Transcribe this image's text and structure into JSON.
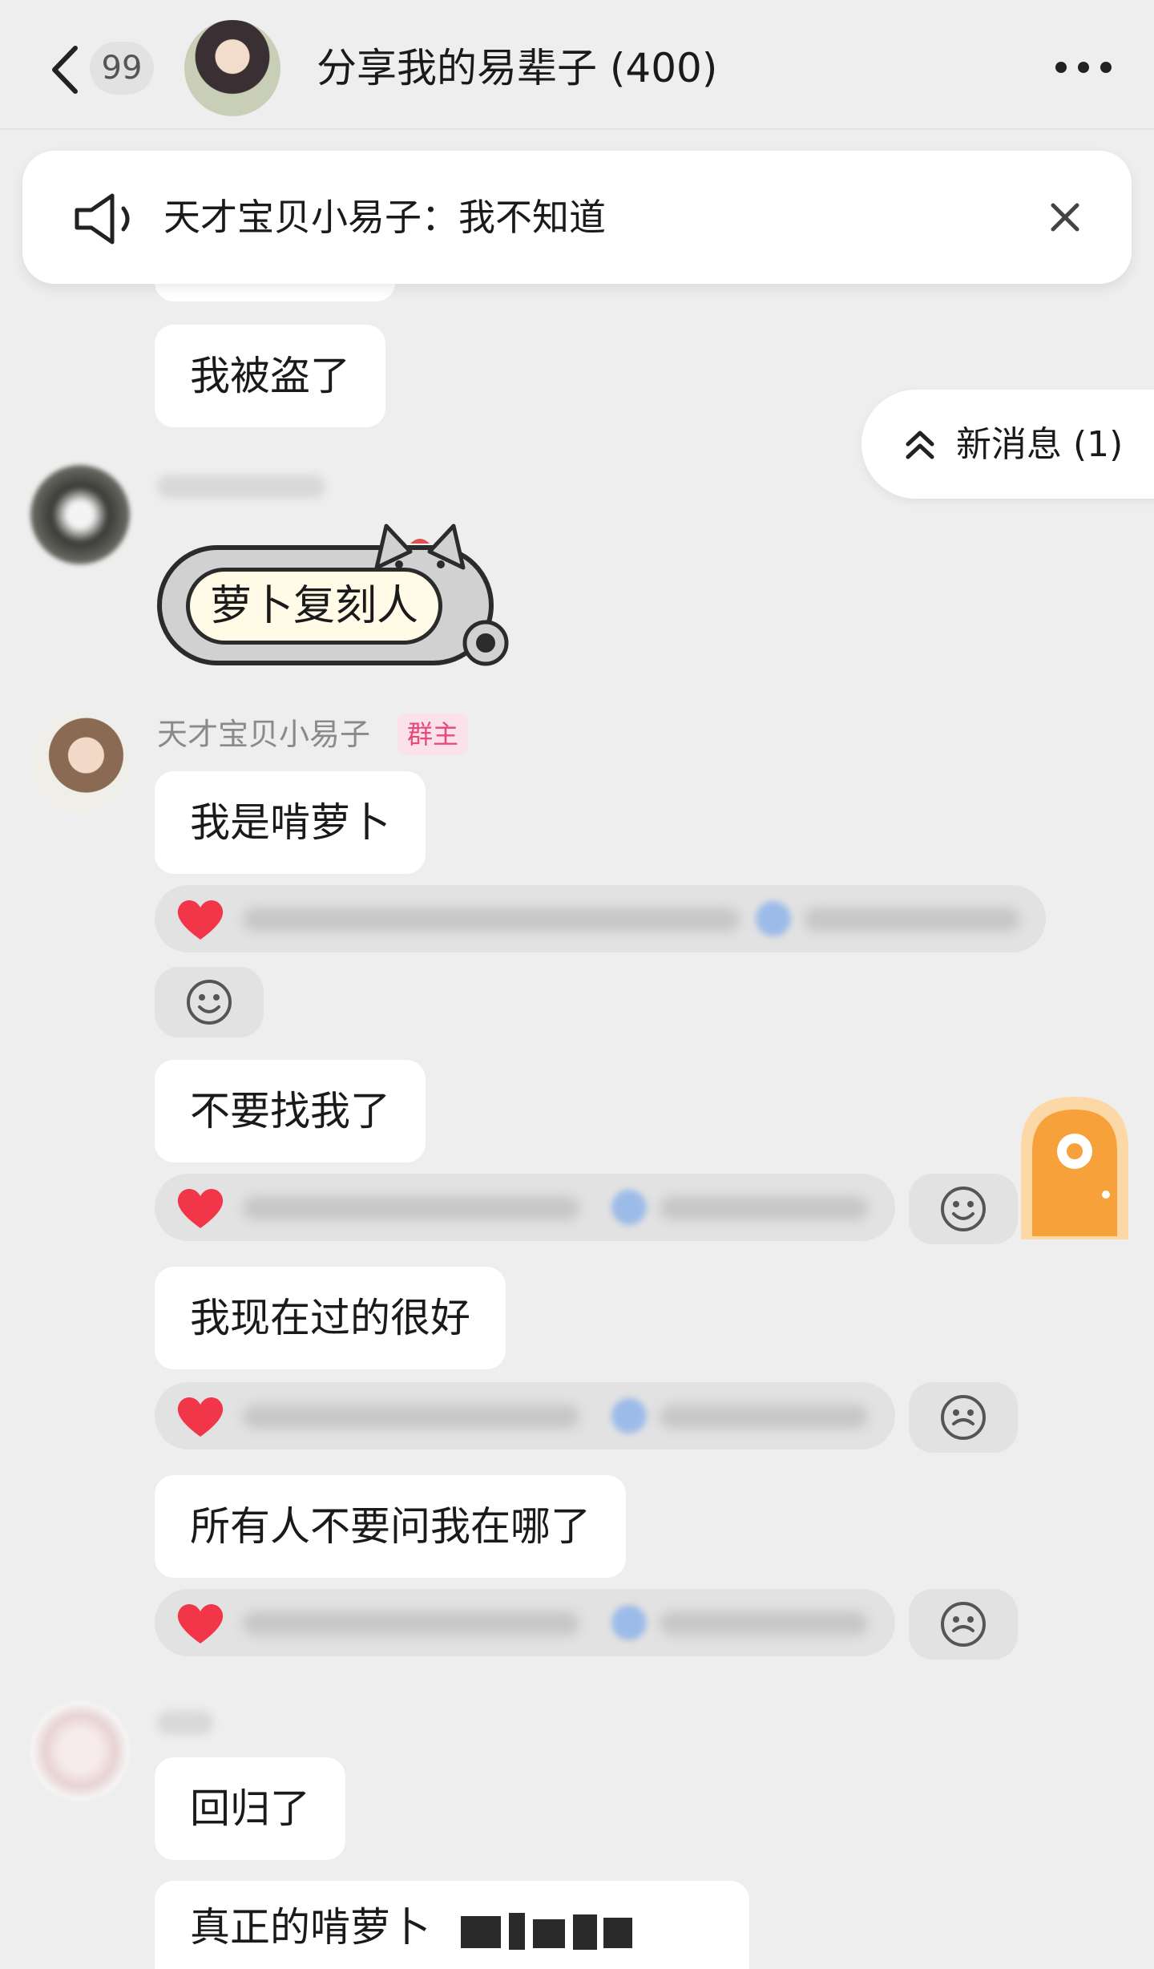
{
  "header": {
    "unread_count": "99",
    "title": "分享我的易辈子 (400)"
  },
  "announcement": {
    "text": "天才宝贝小易子：我不知道"
  },
  "new_messages": {
    "label": "新消息 (1)"
  },
  "messages": [
    {
      "text": "我被盗了"
    },
    {
      "sticker_text": "萝卜复刻人"
    },
    {
      "sender": "天才宝贝小易子",
      "badge": "群主",
      "text": "我是啃萝卜"
    },
    {
      "text": "不要找我了"
    },
    {
      "text": "我现在过的很好"
    },
    {
      "text": "所有人不要问我在哪了"
    },
    {
      "text": "回归了"
    },
    {
      "text": "真正的啃萝卜"
    }
  ],
  "colors": {
    "background": "#eeeeee",
    "bubble": "#ffffff",
    "reaction_bar": "#e2e2e2",
    "owner_badge_text": "#e54a7a",
    "owner_badge_bg": "#fbe2ea",
    "heart": "#f2364a",
    "door": "#f6a13a"
  }
}
